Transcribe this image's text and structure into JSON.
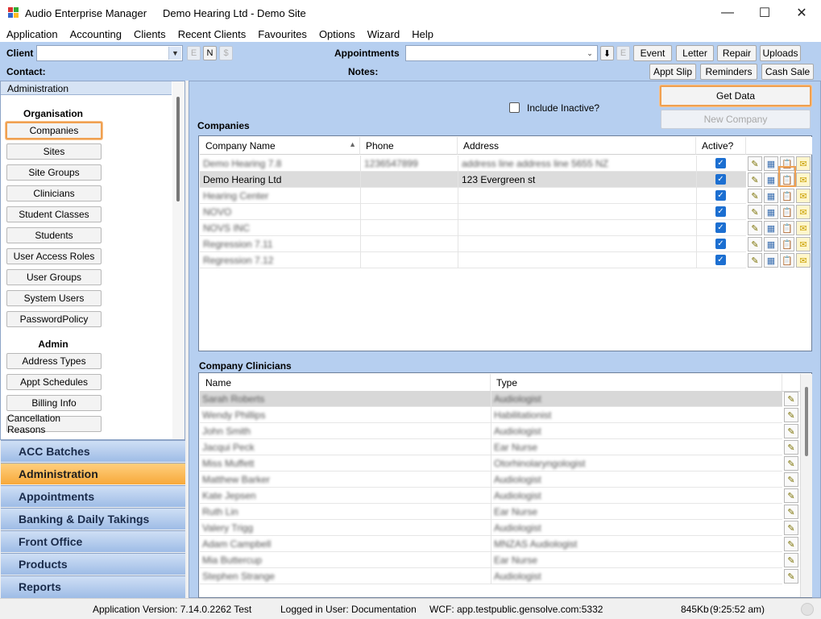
{
  "window": {
    "app_title": "Audio Enterprise Manager",
    "doc_title": "Demo Hearing Ltd - Demo Site",
    "minimize": "—",
    "maximize": "☐",
    "close": "✕"
  },
  "menu": [
    "Application",
    "Accounting",
    "Clients",
    "Recent Clients",
    "Favourites",
    "Options",
    "Wizard",
    "Help"
  ],
  "toolbar": {
    "client_label": "Client",
    "contact_label": "Contact:",
    "appointments_label": "Appointments",
    "notes_label": "Notes:",
    "client_mini": [
      "E",
      "N",
      "$"
    ],
    "appt_mini": [
      "⬇",
      "E"
    ],
    "buttons_row1": [
      "Event",
      "Letter",
      "Repair",
      "Uploads"
    ],
    "buttons_row2": [
      "Appt Slip",
      "Reminders",
      "Cash Sale"
    ]
  },
  "left_panel": {
    "header": "Administration",
    "organisation_heading": "Organisation",
    "organisation_items": [
      "Companies",
      "Sites",
      "Site Groups",
      "Clinicians",
      "Student Classes",
      "Students",
      "User Access Roles",
      "User Groups",
      "System Users",
      "PasswordPolicy"
    ],
    "admin_heading": "Admin",
    "admin_items": [
      "Address Types",
      "Appt Schedules",
      "Billing Info",
      "Cancellation Reasons"
    ],
    "selected": "Companies"
  },
  "modules": [
    "ACC Batches",
    "Administration",
    "Appointments",
    "Banking & Daily Takings",
    "Front Office",
    "Products",
    "Reports"
  ],
  "active_module": "Administration",
  "content": {
    "include_inactive_label": "Include Inactive?",
    "get_data_label": "Get Data",
    "new_company_label": "New Company",
    "companies_heading": "Companies",
    "company_columns": [
      "Company Name",
      "Phone",
      "Address",
      "Active?"
    ],
    "companies": [
      {
        "name": "Demo Hearing 7.8",
        "phone": "1236547899",
        "address": "address line address line  5655 NZ",
        "active": true,
        "blur": true
      },
      {
        "name": "Demo Hearing Ltd",
        "phone": "",
        "address": "123 Evergreen st",
        "active": true,
        "blur": false
      },
      {
        "name": "Hearing Center",
        "phone": "",
        "address": "",
        "active": true,
        "blur": true
      },
      {
        "name": "NOVO",
        "phone": "",
        "address": "",
        "active": true,
        "blur": true
      },
      {
        "name": "NOVS INC",
        "phone": "",
        "address": "",
        "active": true,
        "blur": true
      },
      {
        "name": "Regression 7.11",
        "phone": "",
        "address": "",
        "active": true,
        "blur": true
      },
      {
        "name": "Regression 7.12",
        "phone": "",
        "address": "",
        "active": true,
        "blur": true
      }
    ],
    "clinicians_heading": "Company Clinicians",
    "clinician_columns": [
      "Name",
      "Type"
    ],
    "clinicians": [
      {
        "name": "Sarah Roberts",
        "type": "Audiologist"
      },
      {
        "name": "Wendy Phillips",
        "type": "Habilitationist"
      },
      {
        "name": "John Smith",
        "type": "Audiologist"
      },
      {
        "name": "Jacqui Peck",
        "type": "Ear Nurse"
      },
      {
        "name": "Miss Muffett",
        "type": "Otorhinolaryngologist"
      },
      {
        "name": "Matthew Barker",
        "type": "Audiologist"
      },
      {
        "name": "Kate Jepsen",
        "type": "Audiologist"
      },
      {
        "name": "Ruth Lin",
        "type": "Ear Nurse"
      },
      {
        "name": "Valery Trigg",
        "type": "Audiologist"
      },
      {
        "name": "Adam Campbell",
        "type": "MNZAS Audiologist"
      },
      {
        "name": "Mia Buttercup",
        "type": "Ear Nurse"
      },
      {
        "name": "Stephen Strange",
        "type": "Audiologist"
      }
    ]
  },
  "status": {
    "version": "Application Version: 7.14.0.2262 Test",
    "user": "Logged in User: Documentation",
    "wcf": "WCF: app.testpublic.gensolve.com:5332",
    "memory": "845Kb",
    "time": "(9:25:52 am)"
  },
  "colors": {
    "accent_orange": "#f0a050",
    "panel_blue": "#b6cff0",
    "check_blue": "#1c6fd1"
  }
}
